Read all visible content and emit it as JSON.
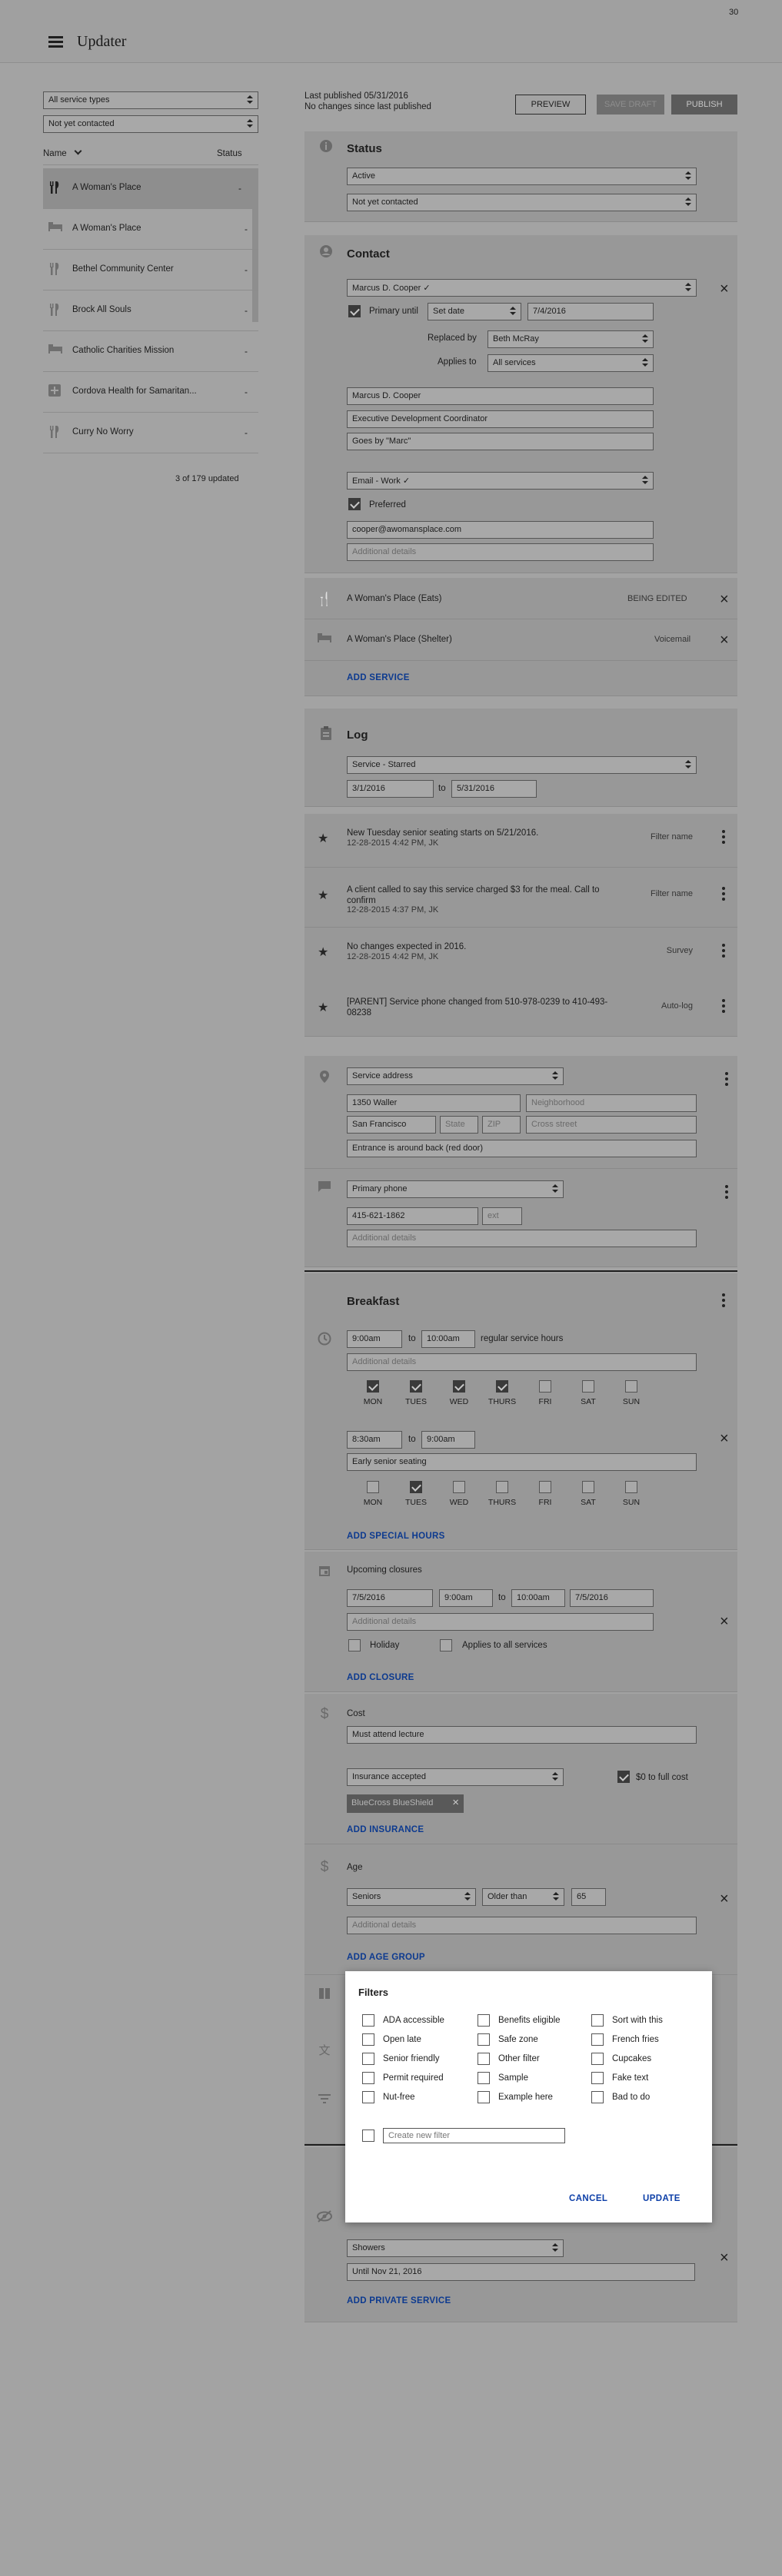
{
  "app": {
    "title": "Updater",
    "counter": "30"
  },
  "sidebar": {
    "filter_type": "All service types",
    "filter_contact": "Not yet contacted",
    "col_name": "Name",
    "col_status": "Status",
    "items": [
      {
        "name": "A Woman's Place",
        "status": "-",
        "icon": "fork-knife-icon"
      },
      {
        "name": "A Woman's Place",
        "status": "-",
        "icon": "bed-icon"
      },
      {
        "name": "Bethel Community Center",
        "status": "-",
        "icon": "fork-knife-icon"
      },
      {
        "name": "Brock All Souls",
        "status": "-",
        "icon": "fork-knife-icon"
      },
      {
        "name": "Catholic Charities Mission",
        "status": "-",
        "icon": "bed-icon"
      },
      {
        "name": "Cordova Health for Samaritan...",
        "status": "-",
        "icon": "plus-icon"
      },
      {
        "name": "Curry No Worry",
        "status": "-",
        "icon": "fork-knife-icon"
      }
    ],
    "updated": "3 of 179 updated"
  },
  "publish": {
    "last_published": "Last published 05/31/2016",
    "no_changes": "No changes since last published",
    "preview": "PREVIEW",
    "save_draft": "SAVE DRAFT",
    "publish": "PUBLISH"
  },
  "status": {
    "title": "Status",
    "active": "Active",
    "contact": "Not yet contacted"
  },
  "contact": {
    "title": "Contact",
    "name_select": "Marcus D. Cooper",
    "primary_until": "Primary until",
    "set_date": "Set date",
    "date": "7/4/2016",
    "replaced_by_label": "Replaced by",
    "replaced_by": "Beth McRay",
    "applies_to_label": "Applies to",
    "applies_to": "All services",
    "full_name": "Marcus D. Cooper",
    "job_title": "Executive Development Coordinator",
    "goes_by": "Goes by \"Marc\"",
    "email_type": "Email - Work",
    "preferred": "Preferred",
    "email": "cooper@awomansplace.com",
    "additional_placeholder": "Additional details"
  },
  "services": [
    {
      "name": "A Woman's Place (Eats)",
      "status": "BEING EDITED"
    },
    {
      "name": "A Woman's Place (Shelter)",
      "status": "Voicemail"
    }
  ],
  "add_service": "ADD SERVICE",
  "log": {
    "title": "Log",
    "filter": "Service - Starred",
    "from": "3/1/2016",
    "to_label": "to",
    "to": "5/31/2016",
    "entries": [
      {
        "text": "New Tuesday senior seating starts on 5/21/2016.",
        "meta": "12-28-2015 4:42 PM, JK",
        "tag": "Filter name"
      },
      {
        "text": "A client called to say this service charged $3 for the meal. Call to confirm",
        "meta": "12-28-2015 4:37 PM, JK",
        "tag": "Filter name"
      },
      {
        "text": "No changes expected in 2016.",
        "meta": "12-28-2015 4:42 PM, JK",
        "tag": "Survey"
      },
      {
        "text": "[PARENT] Service phone changed from 510-978-0239 to 410-493-08238",
        "meta": "",
        "tag": "Auto-log"
      }
    ]
  },
  "address": {
    "type": "Service address",
    "street": "1350 Waller",
    "neighborhood": "Neighborhood",
    "city": "San Francisco",
    "state": "State",
    "zip": "ZIP",
    "cross": "Cross street",
    "note": "Entrance is around back (red door)"
  },
  "phone": {
    "type": "Primary phone",
    "number": "415-621-1862",
    "ext": "ext",
    "additional": "Additional details"
  },
  "breakfast": {
    "title": "Breakfast",
    "start": "9:00am",
    "to": "to",
    "end": "10:00am",
    "regular": "regular service hours",
    "additional": "Additional details",
    "days": [
      "MON",
      "TUES",
      "WED",
      "THURS",
      "FRI",
      "SAT",
      "SUN"
    ],
    "checked1": [
      true,
      true,
      true,
      true,
      false,
      false,
      false
    ],
    "start2": "8:30am",
    "end2": "9:00am",
    "note2": "Early senior seating",
    "checked2": [
      false,
      true,
      false,
      false,
      false,
      false,
      false
    ],
    "add_special": "ADD SPECIAL HOURS"
  },
  "closures": {
    "title": "Upcoming closures",
    "date1": "7/5/2016",
    "time1": "9:00am",
    "to": "to",
    "time2": "10:00am",
    "date2": "7/5/2016",
    "additional": "Additional details",
    "holiday": "Holiday",
    "applies_all": "Applies to all services",
    "add": "ADD CLOSURE"
  },
  "cost": {
    "title": "Cost",
    "note": "Must attend lecture",
    "insurance": "Insurance accepted",
    "zero_full": "$0 to full cost",
    "chip": "BlueCross BlueShield",
    "add": "ADD INSURANCE"
  },
  "age": {
    "title": "Age",
    "group": "Seniors",
    "relation": "Older than",
    "value": "65",
    "additional": "Additional details",
    "add": "ADD AGE GROUP"
  },
  "filters_modal": {
    "title": "Filters",
    "col1": [
      "ADA accessible",
      "Open late",
      "Senior friendly",
      "Permit required",
      "Nut-free"
    ],
    "col2": [
      "Benefits eligible",
      "Safe zone",
      "Other filter",
      "Sample",
      "Example here"
    ],
    "col3": [
      "Sort with this",
      "French fries",
      "Cupcakes",
      "Fake text",
      "Bad to do"
    ],
    "create_placeholder": "Create new filter",
    "cancel": "CANCEL",
    "update": "UPDATE"
  },
  "private": {
    "service": "Showers",
    "until": "Until Nov 21, 2016",
    "add": "ADD PRIVATE SERVICE"
  }
}
